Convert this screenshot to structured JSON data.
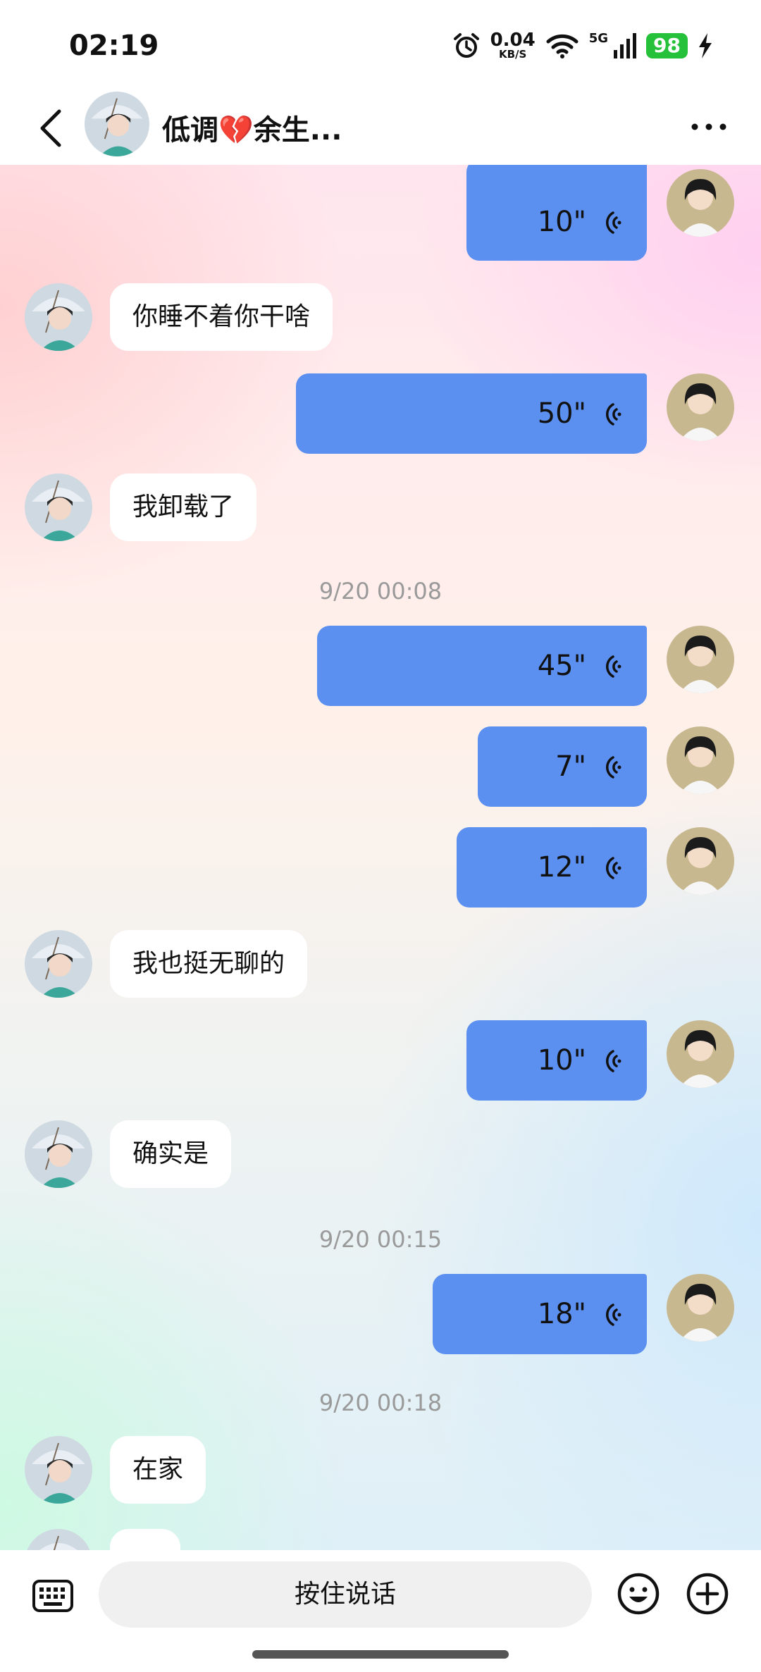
{
  "status_bar": {
    "time": "02:19",
    "net_speed_value": "0.04",
    "net_speed_unit": "KB/S",
    "network": "5G",
    "battery": "98",
    "battery_color": "#26c13b"
  },
  "header": {
    "title": "低调💔余生...",
    "back_icon": "chevron-left-icon",
    "more_icon": "more-dots-icon"
  },
  "colors": {
    "voice_bubble": "#5b8ff0",
    "text_bubble": "#ffffff",
    "timestamp_text": "#9a9a9a"
  },
  "messages": [
    {
      "side": "right",
      "type": "voice",
      "duration": "10\""
    },
    {
      "side": "left",
      "type": "text",
      "text": "你睡不着你干啥"
    },
    {
      "side": "right",
      "type": "voice",
      "duration": "50\""
    },
    {
      "side": "left",
      "type": "text",
      "text": "我卸载了"
    },
    {
      "type": "time",
      "text": "9/20 00:08"
    },
    {
      "side": "right",
      "type": "voice",
      "duration": "45\""
    },
    {
      "side": "right",
      "type": "voice",
      "duration": "7\""
    },
    {
      "side": "right",
      "type": "voice",
      "duration": "12\""
    },
    {
      "side": "left",
      "type": "text",
      "text": "我也挺无聊的"
    },
    {
      "side": "right",
      "type": "voice",
      "duration": "10\""
    },
    {
      "side": "left",
      "type": "text",
      "text": "确实是"
    },
    {
      "type": "time",
      "text": "9/20 00:15"
    },
    {
      "side": "right",
      "type": "voice",
      "duration": "18\""
    },
    {
      "type": "time",
      "text": "9/20 00:18"
    },
    {
      "side": "left",
      "type": "text",
      "text": "在家"
    },
    {
      "side": "left",
      "type": "text",
      "text": ""
    }
  ],
  "input_bar": {
    "hold_to_talk": "按住说话",
    "keyboard_icon": "keyboard-icon",
    "emoji_icon": "emoji-icon",
    "plus_icon": "plus-circle-icon"
  }
}
